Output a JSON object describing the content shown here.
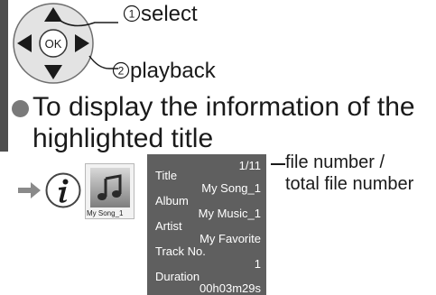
{
  "remote": {
    "center_button_label": "OK",
    "select_number": "1",
    "select_label": "select",
    "playback_number": "2",
    "playback_label": "playback"
  },
  "instruction": {
    "line1": "To display the information of the",
    "line2": "highlighted title"
  },
  "icons": {
    "arrow": "right-arrow-icon",
    "info_button": "info-i-icon",
    "thumbnail_art": "music-note-icon"
  },
  "thumbnail": {
    "caption": "My Song_1"
  },
  "info_panel": {
    "file_counter": "1/11",
    "rows": [
      {
        "label": "Title",
        "value": "My Song_1"
      },
      {
        "label": "Album",
        "value": "My Music_1"
      },
      {
        "label": "Artist",
        "value": "My Favorite"
      },
      {
        "label": "Track No.",
        "value": "1"
      },
      {
        "label": "Duration",
        "value": "00h03m29s"
      }
    ]
  },
  "annotation": {
    "line1": "file number /",
    "line2": "total file number"
  },
  "colors": {
    "panel_background": "#5f5f5f",
    "margin_bar": "#4f4f4f",
    "dpad_ring": "#d9d9d9",
    "dpad_arrows": "#1a1a1a"
  }
}
